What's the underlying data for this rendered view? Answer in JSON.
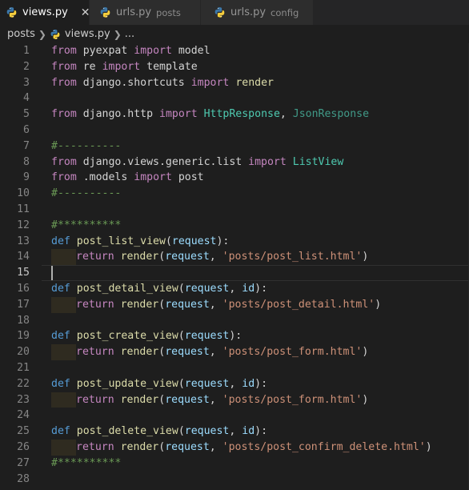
{
  "tabs": [
    {
      "name": "views.py",
      "desc": "",
      "active": true,
      "close": "✕"
    },
    {
      "name": "urls.py",
      "desc": "posts",
      "active": false
    },
    {
      "name": "urls.py",
      "desc": "config",
      "active": false
    }
  ],
  "breadcrumb": {
    "folder": "posts",
    "file": "views.py",
    "more": "..."
  },
  "code": {
    "current_line": 15,
    "lines": [
      {
        "n": "1",
        "t": [
          [
            "kw",
            "from"
          ],
          [
            "plain",
            " "
          ],
          [
            "mod",
            "pyexpat"
          ],
          [
            "plain",
            " "
          ],
          [
            "kw",
            "import"
          ],
          [
            "plain",
            " "
          ],
          [
            "mod",
            "model"
          ]
        ]
      },
      {
        "n": "2",
        "t": [
          [
            "kw",
            "from"
          ],
          [
            "plain",
            " "
          ],
          [
            "mod",
            "re"
          ],
          [
            "plain",
            " "
          ],
          [
            "kw",
            "import"
          ],
          [
            "plain",
            " "
          ],
          [
            "mod",
            "template"
          ]
        ]
      },
      {
        "n": "3",
        "t": [
          [
            "kw",
            "from"
          ],
          [
            "plain",
            " "
          ],
          [
            "mod",
            "django.shortcuts"
          ],
          [
            "plain",
            " "
          ],
          [
            "kw",
            "import"
          ],
          [
            "plain",
            " "
          ],
          [
            "fn",
            "render"
          ]
        ]
      },
      {
        "n": "4",
        "t": []
      },
      {
        "n": "5",
        "t": [
          [
            "kw",
            "from"
          ],
          [
            "plain",
            " "
          ],
          [
            "mod",
            "django.http"
          ],
          [
            "plain",
            " "
          ],
          [
            "kw",
            "import"
          ],
          [
            "plain",
            " "
          ],
          [
            "cls",
            "HttpResponse"
          ],
          [
            "plain",
            ", "
          ],
          [
            "cls dim",
            "JsonResponse"
          ]
        ]
      },
      {
        "n": "6",
        "t": []
      },
      {
        "n": "7",
        "t": [
          [
            "cmt",
            "#----------"
          ]
        ]
      },
      {
        "n": "8",
        "t": [
          [
            "kw",
            "from"
          ],
          [
            "plain",
            " "
          ],
          [
            "mod",
            "django.views.generic.list"
          ],
          [
            "plain",
            " "
          ],
          [
            "kw",
            "import"
          ],
          [
            "plain",
            " "
          ],
          [
            "cls",
            "ListView"
          ]
        ]
      },
      {
        "n": "9",
        "t": [
          [
            "kw",
            "from"
          ],
          [
            "plain",
            " "
          ],
          [
            "mod",
            ".models"
          ],
          [
            "plain",
            " "
          ],
          [
            "kw",
            "import"
          ],
          [
            "plain",
            " "
          ],
          [
            "mod",
            "post"
          ]
        ]
      },
      {
        "n": "10",
        "t": [
          [
            "cmt",
            "#----------"
          ]
        ]
      },
      {
        "n": "11",
        "t": []
      },
      {
        "n": "12",
        "t": [
          [
            "cmt",
            "#**********"
          ]
        ]
      },
      {
        "n": "13",
        "t": [
          [
            "def",
            "def"
          ],
          [
            "plain",
            " "
          ],
          [
            "fn",
            "post_list_view"
          ],
          [
            "plain",
            "("
          ],
          [
            "var",
            "request"
          ],
          [
            "plain",
            "):"
          ]
        ]
      },
      {
        "n": "14",
        "t": [
          [
            "indent",
            ""
          ],
          [
            "kw",
            "return"
          ],
          [
            "plain",
            " "
          ],
          [
            "fn",
            "render"
          ],
          [
            "plain",
            "("
          ],
          [
            "var",
            "request"
          ],
          [
            "plain",
            ", "
          ],
          [
            "str",
            "'posts/post_list.html'"
          ],
          [
            "plain",
            ")"
          ]
        ]
      },
      {
        "n": "15",
        "t": [],
        "caret": true
      },
      {
        "n": "16",
        "t": [
          [
            "def",
            "def"
          ],
          [
            "plain",
            " "
          ],
          [
            "fn",
            "post_detail_view"
          ],
          [
            "plain",
            "("
          ],
          [
            "var",
            "request"
          ],
          [
            "plain",
            ", "
          ],
          [
            "var",
            "id"
          ],
          [
            "plain",
            "):"
          ]
        ]
      },
      {
        "n": "17",
        "t": [
          [
            "indent",
            ""
          ],
          [
            "kw",
            "return"
          ],
          [
            "plain",
            " "
          ],
          [
            "fn",
            "render"
          ],
          [
            "plain",
            "("
          ],
          [
            "var",
            "request"
          ],
          [
            "plain",
            ", "
          ],
          [
            "str",
            "'posts/post_detail.html'"
          ],
          [
            "plain",
            ")"
          ]
        ]
      },
      {
        "n": "18",
        "t": []
      },
      {
        "n": "19",
        "t": [
          [
            "def",
            "def"
          ],
          [
            "plain",
            " "
          ],
          [
            "fn",
            "post_create_view"
          ],
          [
            "plain",
            "("
          ],
          [
            "var",
            "request"
          ],
          [
            "plain",
            "):"
          ]
        ]
      },
      {
        "n": "20",
        "t": [
          [
            "indent",
            ""
          ],
          [
            "kw",
            "return"
          ],
          [
            "plain",
            " "
          ],
          [
            "fn",
            "render"
          ],
          [
            "plain",
            "("
          ],
          [
            "var",
            "request"
          ],
          [
            "plain",
            ", "
          ],
          [
            "str",
            "'posts/post_form.html'"
          ],
          [
            "plain",
            ")"
          ]
        ]
      },
      {
        "n": "21",
        "t": []
      },
      {
        "n": "22",
        "t": [
          [
            "def",
            "def"
          ],
          [
            "plain",
            " "
          ],
          [
            "fn",
            "post_update_view"
          ],
          [
            "plain",
            "("
          ],
          [
            "var",
            "request"
          ],
          [
            "plain",
            ", "
          ],
          [
            "var",
            "id"
          ],
          [
            "plain",
            "):"
          ]
        ]
      },
      {
        "n": "23",
        "t": [
          [
            "indent",
            ""
          ],
          [
            "kw",
            "return"
          ],
          [
            "plain",
            " "
          ],
          [
            "fn",
            "render"
          ],
          [
            "plain",
            "("
          ],
          [
            "var",
            "request"
          ],
          [
            "plain",
            ", "
          ],
          [
            "str",
            "'posts/post_form.html'"
          ],
          [
            "plain",
            ")"
          ]
        ]
      },
      {
        "n": "24",
        "t": []
      },
      {
        "n": "25",
        "t": [
          [
            "def",
            "def"
          ],
          [
            "plain",
            " "
          ],
          [
            "fn",
            "post_delete_view"
          ],
          [
            "plain",
            "("
          ],
          [
            "var",
            "request"
          ],
          [
            "plain",
            ", "
          ],
          [
            "var",
            "id"
          ],
          [
            "plain",
            "):"
          ]
        ]
      },
      {
        "n": "26",
        "t": [
          [
            "indent",
            ""
          ],
          [
            "kw",
            "return"
          ],
          [
            "plain",
            " "
          ],
          [
            "fn",
            "render"
          ],
          [
            "plain",
            "("
          ],
          [
            "var",
            "request"
          ],
          [
            "plain",
            ", "
          ],
          [
            "str",
            "'posts/post_confirm_delete.html'"
          ],
          [
            "plain",
            ")"
          ]
        ]
      },
      {
        "n": "27",
        "t": [
          [
            "cmt",
            "#**********"
          ]
        ]
      },
      {
        "n": "28",
        "t": []
      }
    ]
  },
  "colors": {
    "background": "#1e1e1e",
    "tabbar": "#252526",
    "keyword": "#c586c0",
    "def": "#569cd6",
    "function": "#dcdcaa",
    "parameter": "#9cdcfe",
    "class": "#4ec9b0",
    "string": "#ce9178",
    "comment": "#6a9955"
  },
  "icons": {
    "file": "python-icon",
    "close": "close-icon",
    "separator": "chevron-right-icon"
  }
}
